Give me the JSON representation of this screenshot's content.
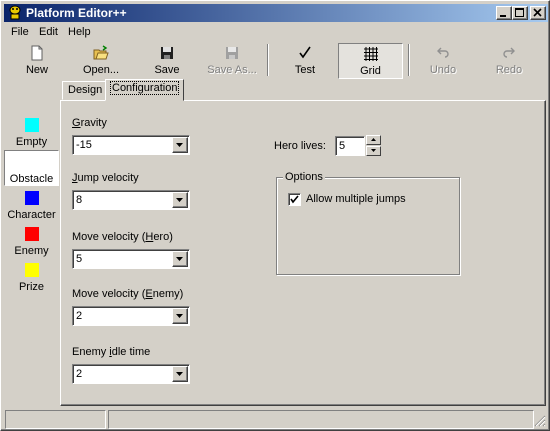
{
  "window": {
    "title": "Platform Editor++"
  },
  "menu": [
    {
      "label": "File"
    },
    {
      "label": "Edit"
    },
    {
      "label": "Help"
    }
  ],
  "toolbar": {
    "new_label": "New",
    "open_label": "Open...",
    "save_label": "Save",
    "save_as_label": "Save As...",
    "test_label": "Test",
    "grid_label": "Grid",
    "undo_label": "Undo",
    "redo_label": "Redo",
    "grid_pressed": true
  },
  "palette": [
    {
      "label": "Empty",
      "color": "#00ffff"
    },
    {
      "label": "Obstacle",
      "color": "#ffffff",
      "selected": true
    },
    {
      "label": "Character",
      "color": "#0000ff"
    },
    {
      "label": "Enemy",
      "color": "#ff0000"
    },
    {
      "label": "Prize",
      "color": "#ffff00"
    }
  ],
  "tabs": [
    {
      "label": "Design",
      "active": false
    },
    {
      "label": "Configuration",
      "active": true
    }
  ],
  "config": {
    "gravity": {
      "label_pre": "",
      "label_key": "G",
      "label_post": "ravity",
      "value": "-15"
    },
    "jump_velocity": {
      "label_pre": "",
      "label_key": "J",
      "label_post": "ump velocity",
      "value": "8"
    },
    "move_velocity_hero": {
      "label_pre": "Move velocity (",
      "label_key": "H",
      "label_post": "ero)",
      "value": "5"
    },
    "move_velocity_enemy": {
      "label_pre": "Move velocity (",
      "label_key": "E",
      "label_post": "nemy)",
      "value": "2"
    },
    "enemy_idle_time": {
      "label_pre": "Enemy ",
      "label_key": "i",
      "label_post": "dle time",
      "value": "2"
    },
    "hero_lives": {
      "label": "Hero lives:",
      "value": "5"
    },
    "options": {
      "title": "Options",
      "allow_multiple_jumps": {
        "label": "Allow multiple jumps",
        "checked": true
      }
    }
  },
  "colors": {
    "face": "#d4d0c8",
    "title_start": "#0a246a",
    "title_end": "#a6caf0"
  }
}
